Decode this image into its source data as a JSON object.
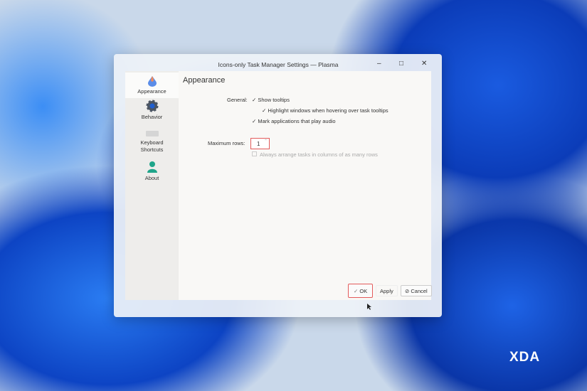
{
  "window": {
    "title": "Icons-only Task Manager Settings — Plasma",
    "minimize": "–",
    "maximize": "□",
    "close": "✕"
  },
  "sidebar": {
    "items": [
      {
        "label": "Appearance"
      },
      {
        "label": "Behavior"
      },
      {
        "label": "Keyboard Shortcuts"
      },
      {
        "label": "About"
      }
    ]
  },
  "main": {
    "heading": "Appearance",
    "general_label": "General:",
    "options": [
      {
        "label": "Show tooltips",
        "checked": true
      },
      {
        "label": "Highlight windows when hovering over task tooltips",
        "checked": true
      },
      {
        "label": "Mark applications that play audio",
        "checked": true
      }
    ],
    "max_rows_label": "Maximum rows:",
    "max_rows_value": "1",
    "columns_option": {
      "label": "Always arrange tasks in columns of as many rows",
      "checked": false,
      "disabled": true
    }
  },
  "buttons": {
    "ok": "OK",
    "apply": "Apply",
    "cancel": "Cancel"
  },
  "watermark": "XDA"
}
